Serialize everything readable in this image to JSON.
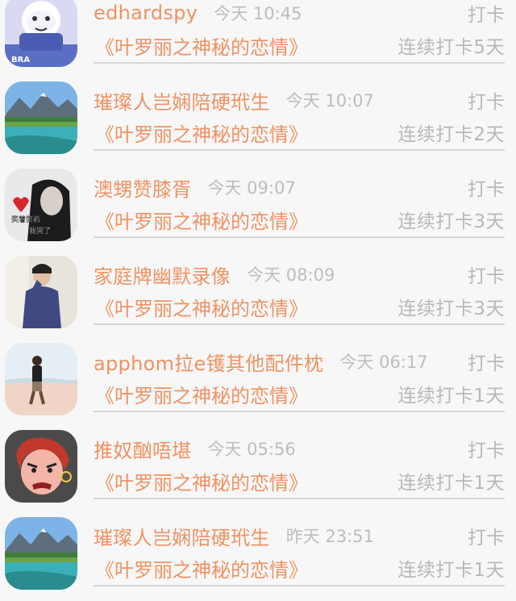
{
  "checkin_records": [
    {
      "user": "edhardspy",
      "time": "今天 10:45",
      "action": "打卡",
      "book": "《叶罗丽之神秘的恋情》",
      "streak": "连续打卡5天",
      "avatar": "cartoon-avatar-icon",
      "avatar_text": "BRA"
    },
    {
      "user": "璀璨人岂娴陪硬玳生",
      "time": "今天 10:07",
      "action": "打卡",
      "book": "《叶罗丽之神秘的恋情》",
      "streak": "连续打卡2天",
      "avatar": "mountain-lake-icon"
    },
    {
      "user": "澳甥赞膝胥",
      "time": "今天 09:07",
      "action": "打卡",
      "book": "《叶罗丽之神秘的恋情》",
      "streak": "连续打卡3天",
      "avatar": "girl-with-heart-icon",
      "avatar_text": "笑着笑着 我哭了"
    },
    {
      "user": "家庭牌幽默录像",
      "time": "今天 08:09",
      "action": "打卡",
      "book": "《叶罗丽之神秘的恋情》",
      "streak": "连续打卡3天",
      "avatar": "man-portrait-icon"
    },
    {
      "user": "apphom拉e镬其他配件枕",
      "time": "今天 06:17",
      "action": "打卡",
      "book": "《叶罗丽之神秘的恋情》",
      "streak": "连续打卡1天",
      "avatar": "beach-walker-icon"
    },
    {
      "user": "推奴酗唔堪",
      "time": "今天 05:56",
      "action": "打卡",
      "book": "《叶罗丽之神秘的恋情》",
      "streak": "连续打卡1天",
      "avatar": "cartoon-face-icon"
    },
    {
      "user": "璀璨人岂娴陪硬玳生",
      "time": "昨天 23:51",
      "action": "打卡",
      "book": "《叶罗丽之神秘的恋情》",
      "streak": "连续打卡1天",
      "avatar": "mountain-lake-icon"
    }
  ]
}
